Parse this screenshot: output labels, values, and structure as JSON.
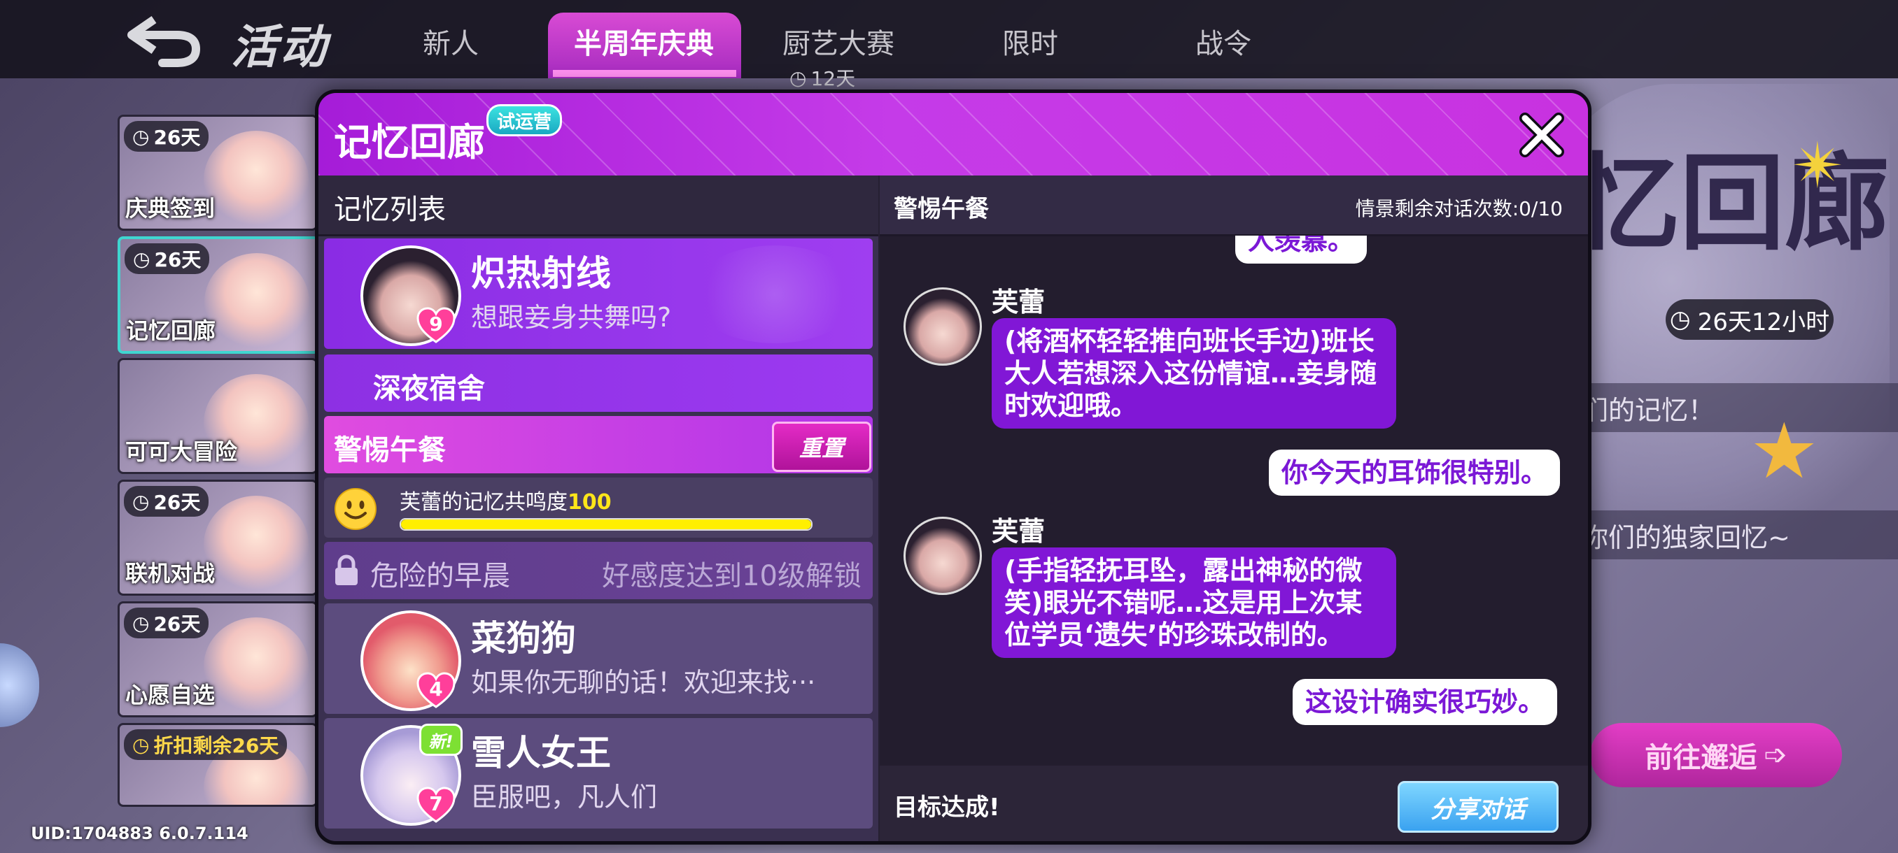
{
  "nav": {
    "title": "活动",
    "tabs": [
      "新人",
      "半周年庆典",
      "厨艺大赛",
      "限时",
      "战令"
    ],
    "active_tab_timer": "12天"
  },
  "side_events": [
    {
      "timer": "26天",
      "label": "庆典签到"
    },
    {
      "timer": "26天",
      "label": "记忆回廊"
    },
    {
      "timer": "",
      "label": "可可大冒险"
    },
    {
      "timer": "26天",
      "label": "联机对战"
    },
    {
      "timer": "26天",
      "label": "心愿自选"
    },
    {
      "timer": "折扣剩余26天",
      "label": ""
    }
  ],
  "background_panel": {
    "title": "忆回廊",
    "timer": "26天12小时",
    "line1": "们的记忆！",
    "line2": "你们的独家回忆~",
    "goto_button": "前往邂逅"
  },
  "uid": "UID:1704883 6.0.7.114",
  "modal": {
    "title": "记忆回廊",
    "badge": "试运营",
    "list_title": "记忆列表",
    "memories": [
      {
        "name": "炽热射线",
        "quote": "想跟妾身共舞吗?",
        "level": "9"
      },
      {
        "name": "菜狗狗",
        "quote": "如果你无聊的话！欢迎来找···",
        "level": "4"
      },
      {
        "name": "雪人女王",
        "quote": "臣服吧，凡人们",
        "level": "7",
        "badge": "新!"
      }
    ],
    "sub_scenes": {
      "scene1": "深夜宿舍",
      "scene2": "警惕午餐",
      "reset_button": "重置",
      "locked_scene": "危险的早晨",
      "locked_hint": "好感度达到10级解锁"
    },
    "resonance": {
      "label": "芙蕾的记忆共鸣度",
      "value": "100",
      "fill": 1.0
    },
    "chat": {
      "title": "警惕午餐",
      "count": "情景剩余对话次数:0/10",
      "partial_top": "人羡慕。",
      "speaker": "芙蕾",
      "msg1": "(将酒杯轻轻推向班长手边)班长大人若想深入这份情谊…妾身随时欢迎哦。",
      "reply1": "你今天的耳饰很特别。",
      "msg2": "(手指轻抚耳坠，露出神秘的微笑)眼光不错呢…这是用上次某位学员‘遗失’的珍珠改制的。",
      "reply2": "这设计确实很巧妙。",
      "goal": "目标达成!",
      "share_button": "分享对话"
    }
  },
  "colors": {
    "accent_purple": "#8117d6",
    "header_purple": "#c53be8",
    "resonance_yellow": "#ffef00",
    "share_blue": "#3aa2f0"
  }
}
